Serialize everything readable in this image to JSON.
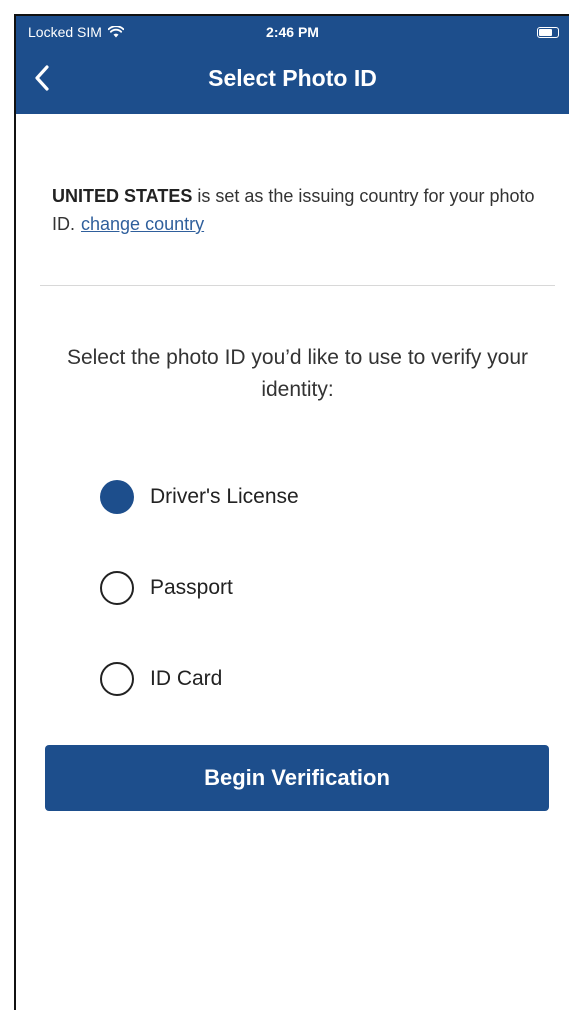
{
  "status_bar": {
    "carrier": "Locked SIM",
    "time": "2:46 PM",
    "wifi_icon": "wifi-icon",
    "battery_icon": "battery-icon"
  },
  "header": {
    "title": "Select Photo ID",
    "back_icon": "chevron-left-icon",
    "background_color": "#1d4e8c"
  },
  "country_notice": {
    "country": "UNITED STATES",
    "text": " is set as the issuing country for your photo ID.",
    "change_link": "change country"
  },
  "prompt": "Select the photo ID you’d like to use to verify your identity:",
  "options": [
    {
      "label": "Driver's License",
      "selected": true
    },
    {
      "label": "Passport",
      "selected": false
    },
    {
      "label": "ID Card",
      "selected": false
    }
  ],
  "primary_button": {
    "label": "Begin Verification",
    "color": "#1d4e8c"
  }
}
